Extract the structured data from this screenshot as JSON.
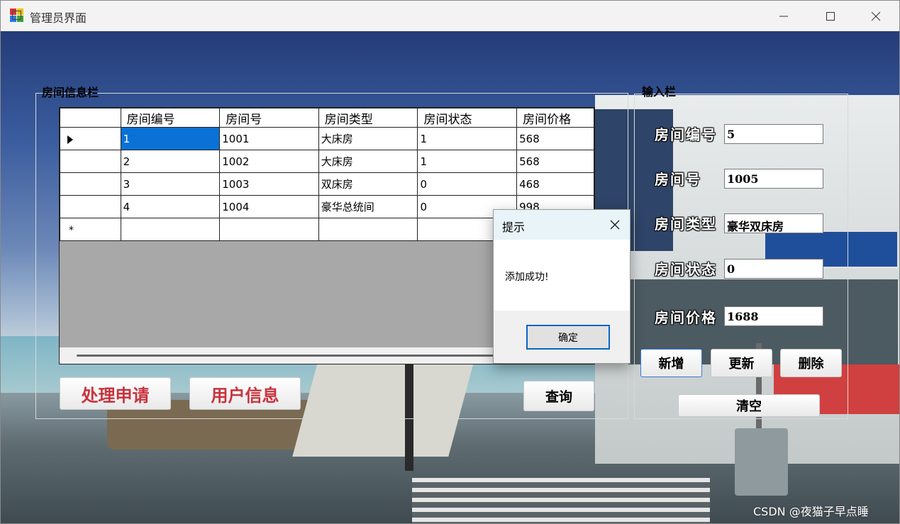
{
  "window": {
    "title": "管理员界面",
    "controls": [
      "minimize-icon",
      "maximize-icon",
      "close-icon"
    ]
  },
  "room_panel": {
    "label": "房间信息栏",
    "columns": [
      "房间编号",
      "房间号",
      "房间类型",
      "房间状态",
      "房间价格"
    ],
    "rows": [
      [
        "1",
        "1001",
        "大床房",
        "1",
        "568"
      ],
      [
        "2",
        "1002",
        "大床房",
        "1",
        "568"
      ],
      [
        "3",
        "1003",
        "双床房",
        "0",
        "468"
      ],
      [
        "4",
        "1004",
        "豪华总统间",
        "0",
        "998"
      ]
    ],
    "selected_row": 0,
    "new_row_marker": "*"
  },
  "left_buttons": {
    "process_label": "处理申请",
    "user_info_label": "用户信息",
    "query_label": "查询",
    "text_color": "#c8323c"
  },
  "input_panel": {
    "label": "输入栏",
    "fields": [
      {
        "label": "房间编号",
        "value": "5"
      },
      {
        "label": "房间号",
        "value": "1005"
      },
      {
        "label": "房间类型",
        "value": "豪华双床房"
      },
      {
        "label": "房间状态",
        "value": "0"
      },
      {
        "label": "房间价格",
        "value": "1688"
      }
    ],
    "add_label": "新增",
    "update_label": "更新",
    "delete_label": "删除",
    "clear_label": "清空"
  },
  "dialog": {
    "title": "提示",
    "message": "添加成功!",
    "ok_label": "确定"
  },
  "watermark": "CSDN @夜猫子早点睡",
  "colors": {
    "selection": "#0a72d6",
    "dialog_header": "#e8f4f8",
    "button_red": "#c8323c"
  }
}
